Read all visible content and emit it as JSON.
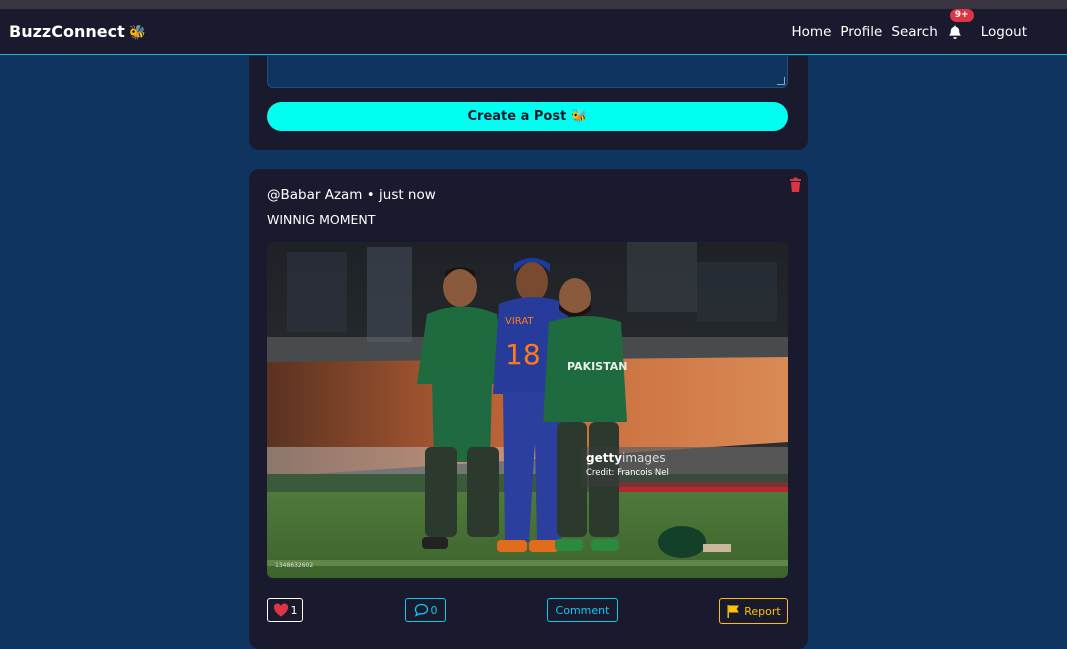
{
  "app": {
    "brand": "BuzzConnect",
    "brand_emoji": "🐝"
  },
  "nav": {
    "links": [
      "Home",
      "Profile",
      "Search"
    ],
    "notification_badge": "9+",
    "logout": "Logout"
  },
  "composer": {
    "create_button": "Create a Post",
    "create_emoji": "🐝"
  },
  "post": {
    "meta": "@Babar Azam • just now",
    "text": "WINNIG MOMENT",
    "image": {
      "watermark_brand": "getty",
      "watermark_brand_suffix": "images",
      "credit": "Credit: Francois Nel",
      "image_id": "1348632602",
      "jersey_name": "VIRAT",
      "jersey_number": "18",
      "team_text": "PAKISTAN"
    },
    "likes": "1",
    "comments_count": "0",
    "comment_label": "Comment",
    "report_label": "Report"
  },
  "colors": {
    "page_bg": "#0f3460",
    "card_bg": "#1a1a2e",
    "accent": "#00fff0",
    "info": "#0dcaf0",
    "danger": "#dc3545",
    "warning": "#ffc107"
  }
}
